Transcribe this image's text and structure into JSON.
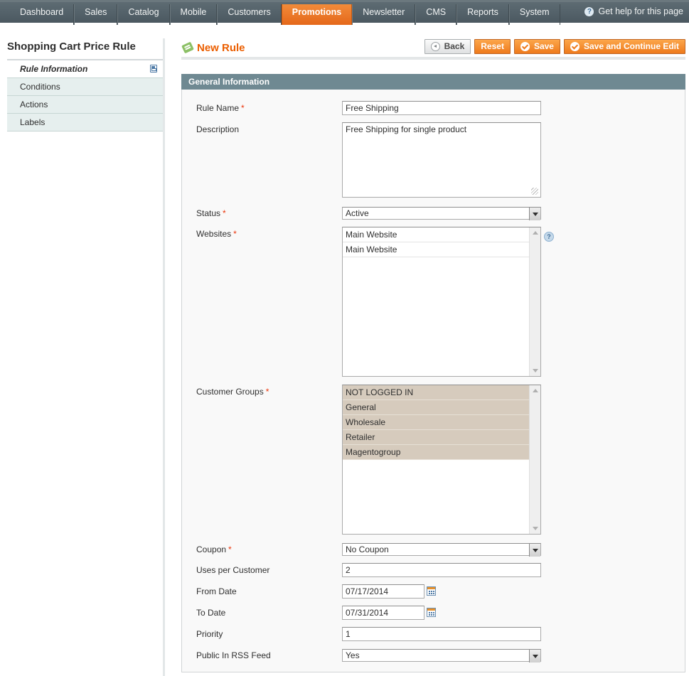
{
  "nav": {
    "items": [
      "Dashboard",
      "Sales",
      "Catalog",
      "Mobile",
      "Customers",
      "Promotions",
      "Newsletter",
      "CMS",
      "Reports",
      "System"
    ],
    "active": "Promotions",
    "help": "Get help for this page"
  },
  "sidebar": {
    "title": "Shopping Cart Price Rule",
    "tabs": [
      "Rule Information",
      "Conditions",
      "Actions",
      "Labels"
    ]
  },
  "header": {
    "title": "New Rule",
    "back": "Back",
    "reset": "Reset",
    "save": "Save",
    "save_continue": "Save and Continue Edit"
  },
  "section": {
    "title": "General Information"
  },
  "form": {
    "rule_name": {
      "label": "Rule Name",
      "value": "Free Shipping"
    },
    "description": {
      "label": "Description",
      "value": "Free Shipping for single product"
    },
    "status": {
      "label": "Status",
      "value": "Active"
    },
    "websites": {
      "label": "Websites",
      "options": [
        "Main Website",
        "Main Website"
      ]
    },
    "customer_groups": {
      "label": "Customer Groups",
      "options": [
        "NOT LOGGED IN",
        "General",
        "Wholesale",
        "Retailer",
        "Magentogroup"
      ]
    },
    "coupon": {
      "label": "Coupon",
      "value": "No Coupon"
    },
    "uses_per_customer": {
      "label": "Uses per Customer",
      "value": "2"
    },
    "from_date": {
      "label": "From Date",
      "value": "07/17/2014"
    },
    "to_date": {
      "label": "To Date",
      "value": "07/31/2014"
    },
    "priority": {
      "label": "Priority",
      "value": "1"
    },
    "rss": {
      "label": "Public In RSS Feed",
      "value": "Yes"
    }
  },
  "colors": {
    "accent": "#eb5e00",
    "nav_active": "#ec7a24",
    "section_head": "#6f8992",
    "selected_option": "#d6cbbd"
  }
}
